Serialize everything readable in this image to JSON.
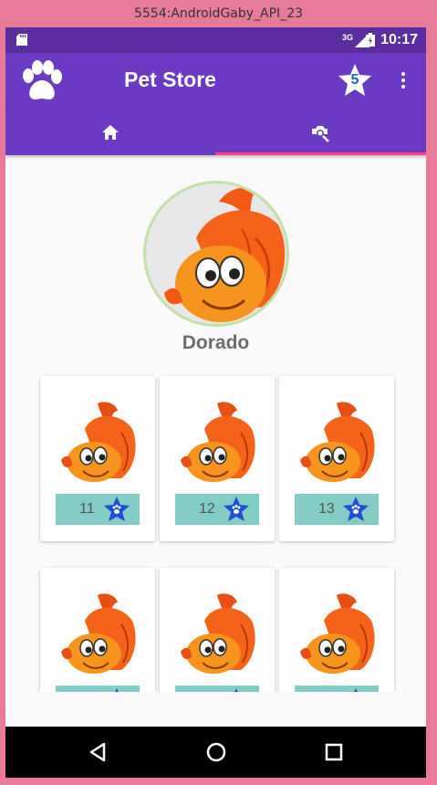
{
  "window": {
    "title": "5554:AndroidGaby_API_23"
  },
  "status_bar": {
    "time": "10:17",
    "signal_label": "3G",
    "icons": [
      "sd-card-icon",
      "signal-icon",
      "battery-icon"
    ]
  },
  "app_bar": {
    "title": "Pet Store",
    "star_badge_count": "5",
    "icons": [
      "paw-logo-icon",
      "star-badge-icon",
      "overflow-menu-icon"
    ]
  },
  "tabs": [
    {
      "icon": "home-icon",
      "selected": false
    },
    {
      "icon": "search-pet-icon",
      "selected": true
    }
  ],
  "profile": {
    "name": "Dorado",
    "image": "goldfish-photo"
  },
  "cards": [
    {
      "count": "11",
      "image": "goldfish-icon",
      "badge_icon": "paw-star-icon"
    },
    {
      "count": "12",
      "image": "goldfish-icon",
      "badge_icon": "paw-star-icon"
    },
    {
      "count": "13",
      "image": "goldfish-icon",
      "badge_icon": "paw-star-icon"
    },
    {
      "count": "",
      "image": "goldfish-icon",
      "badge_icon": "paw-star-icon"
    },
    {
      "count": "",
      "image": "goldfish-icon",
      "badge_icon": "paw-star-icon"
    },
    {
      "count": "",
      "image": "goldfish-icon",
      "badge_icon": "paw-star-icon"
    }
  ],
  "nav_bar": {
    "buttons": [
      "back-icon",
      "home-circle-icon",
      "recents-icon"
    ]
  },
  "colors": {
    "frame": "#e87a9a",
    "status_bar": "#5a2e9e",
    "app_bar": "#6a3ac2",
    "tab_indicator": "#ff4081",
    "badge_bg": "#82cdc6",
    "star_blue": "#1d63c4"
  }
}
